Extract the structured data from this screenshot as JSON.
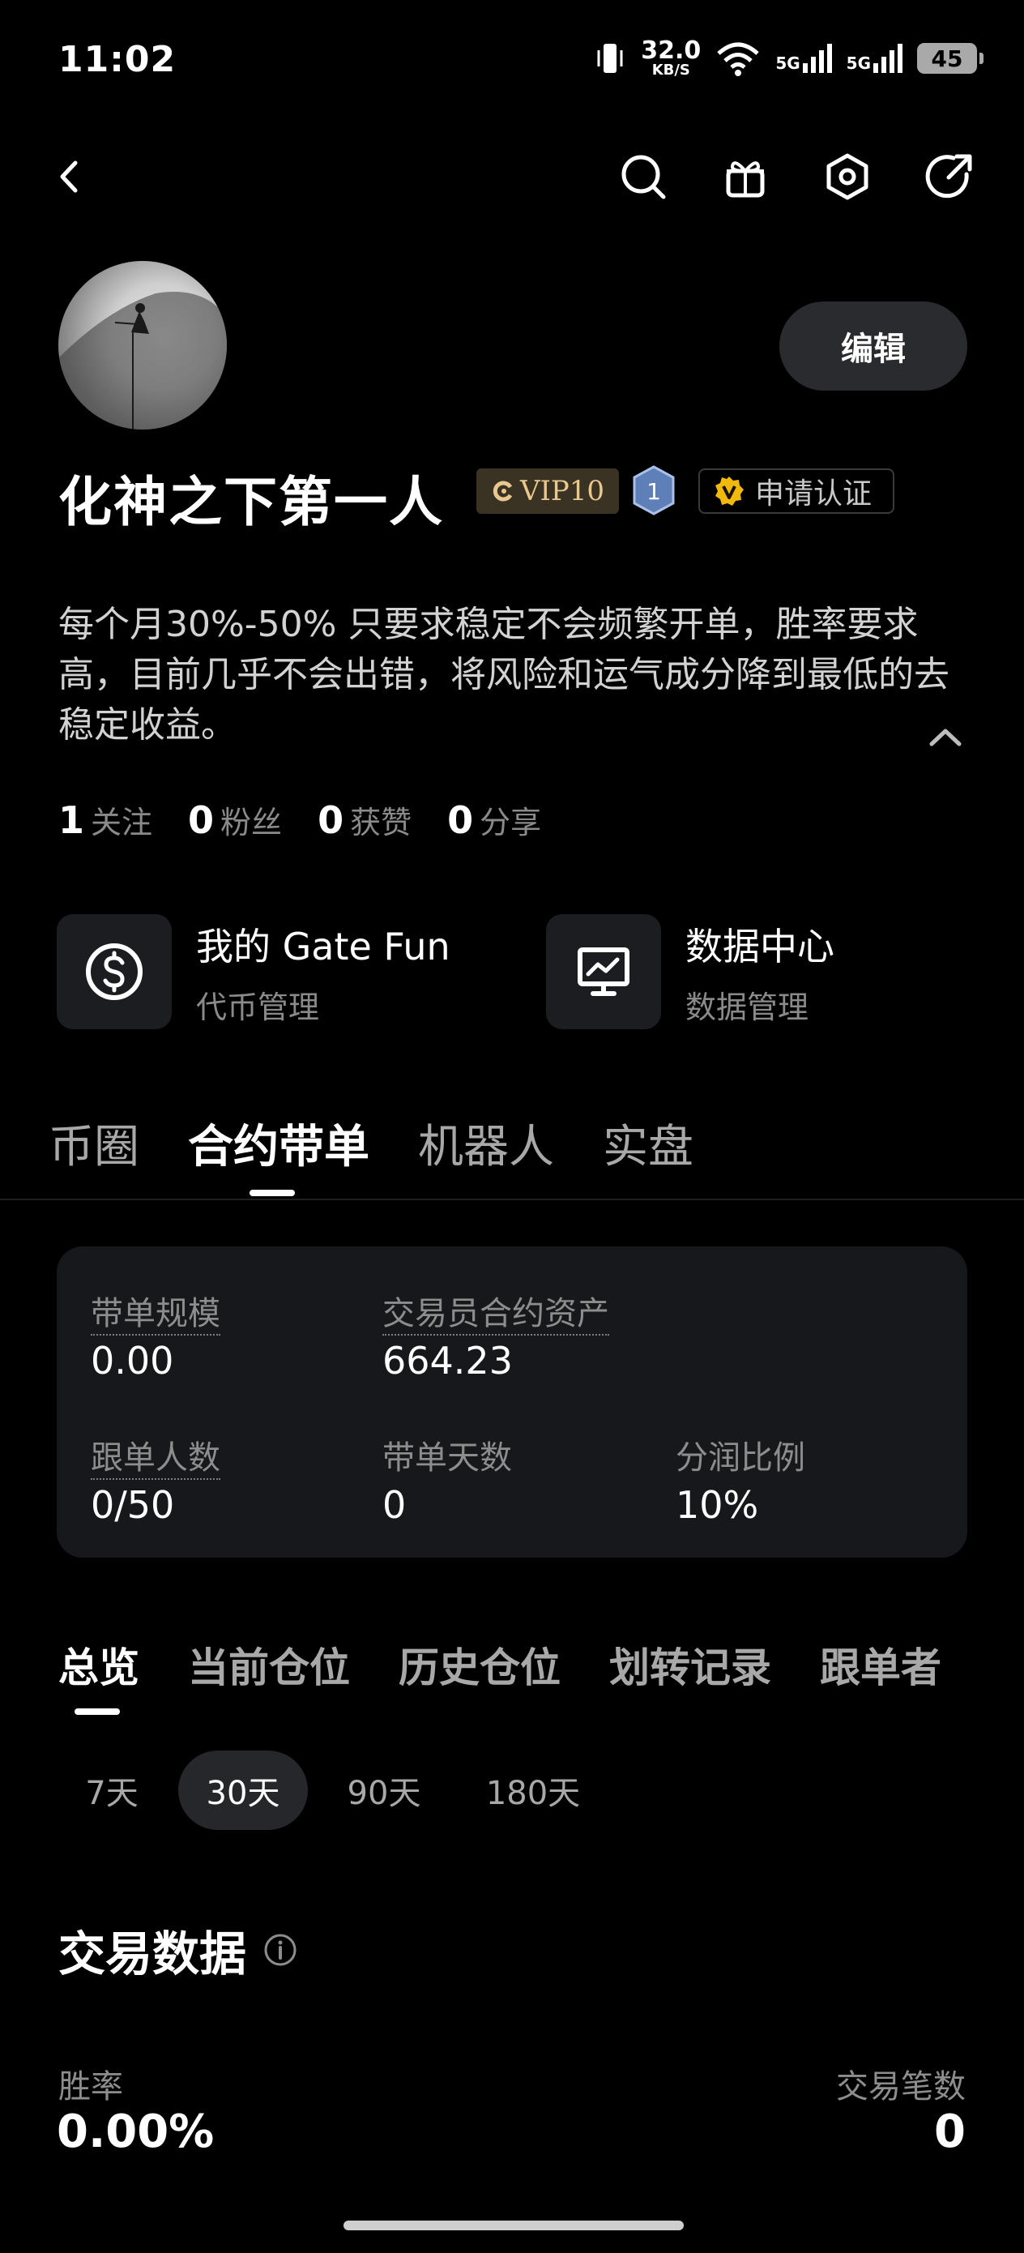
{
  "status_bar": {
    "time": "11:02",
    "net_speed": "32.0",
    "net_unit": "KB/S",
    "signal_1": "5G",
    "signal_2": "5G",
    "battery": "45"
  },
  "nav": {
    "back_icon": "chevron-left-icon",
    "search_icon": "search-icon",
    "gift_icon": "gift-icon",
    "settings_icon": "hexagon-settings-icon",
    "share_icon": "share-arrow-icon"
  },
  "profile": {
    "edit_label": "编辑",
    "username": "化神之下第一人",
    "vip_label": "VIP10",
    "level": "1",
    "verify_label": "申请认证",
    "bio": "每个月30%-50% 只要求稳定不会频繁开单，胜率要求高，目前几乎不会出错，将风险和运气成分降到最低的去稳定收益。",
    "stats": [
      {
        "num": "1",
        "label": "关注"
      },
      {
        "num": "0",
        "label": "粉丝"
      },
      {
        "num": "0",
        "label": "获赞"
      },
      {
        "num": "0",
        "label": "分享"
      }
    ]
  },
  "tools": [
    {
      "title": "我的 Gate Fun",
      "subtitle": "代币管理",
      "icon": "dollar-circle-icon"
    },
    {
      "title": "数据中心",
      "subtitle": "数据管理",
      "icon": "chart-monitor-icon"
    }
  ],
  "main_tabs": [
    "币圈",
    "合约带单",
    "机器人",
    "实盘"
  ],
  "card": {
    "scale_label": "带单规模",
    "scale_value": "0.00",
    "assets_label": "交易员合约资产",
    "assets_value": "664.23",
    "followers_label": "跟单人数",
    "followers_value": "0/50",
    "days_label": "带单天数",
    "days_value": "0",
    "share_label": "分润比例",
    "share_value": "10%"
  },
  "sub_tabs": [
    "总览",
    "当前仓位",
    "历史仓位",
    "划转记录",
    "跟单者"
  ],
  "periods": [
    "7天",
    "30天",
    "90天",
    "180天"
  ],
  "trade_data": {
    "title": "交易数据",
    "win_rate_label": "胜率",
    "win_rate_value": "0.00%",
    "trades_label": "交易笔数",
    "trades_value": "0"
  },
  "colors": {
    "background": "#000000",
    "card": "#17181b",
    "vip_gold": "#e9c88f",
    "muted": "#8d8d8d"
  }
}
